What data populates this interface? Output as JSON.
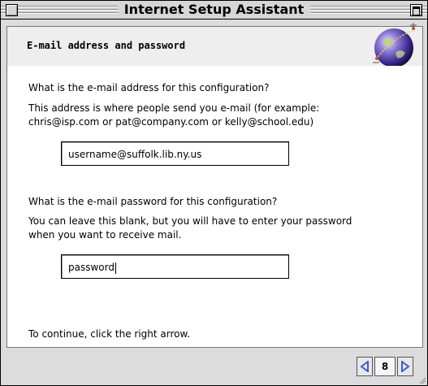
{
  "window": {
    "title": "Internet Setup Assistant"
  },
  "header": {
    "title": "E-mail address and password",
    "icon": "globe-icon"
  },
  "email": {
    "question": "What is the e-mail address for this configuration?",
    "help_line1": "This address is where people send you e-mail (for example:",
    "help_line2": "chris@isp.com or pat@company.com or kelly@school.edu)",
    "value": "username@suffolk.lib.ny.us"
  },
  "password": {
    "question": "What is the e-mail password for this configuration?",
    "help_line1": "You can leave this blank, but you will have to enter your password",
    "help_line2": "when you want to receive mail.",
    "value": "password"
  },
  "footer": {
    "instruction": "To continue, click the right arrow.",
    "page_number": "8",
    "accent": "#3a5fcd"
  }
}
